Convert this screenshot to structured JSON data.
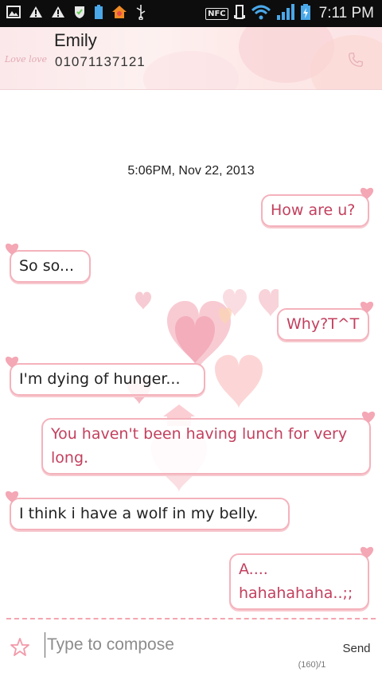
{
  "status_bar": {
    "time": "7:11 PM",
    "nfc_label": "NFC",
    "icons": [
      "image-icon",
      "warning-icon",
      "warning-icon",
      "shield-check-icon",
      "battery-saver-icon",
      "home-app-icon",
      "usb-icon",
      "nfc-icon",
      "vibrate-icon",
      "wifi-icon",
      "signal-icon",
      "battery-charging-icon"
    ]
  },
  "contact": {
    "name": "Emily",
    "number": "01071137121",
    "logo_text": "Love love"
  },
  "conversation": {
    "timestamp": "5:06PM, Nov 22, 2013",
    "messages": [
      {
        "direction": "outgoing",
        "text": "How are u?"
      },
      {
        "direction": "incoming",
        "text": "So so..."
      },
      {
        "direction": "outgoing",
        "text": "Why?T^T"
      },
      {
        "direction": "incoming",
        "text": "I'm dying of hunger..."
      },
      {
        "direction": "outgoing",
        "text": "You haven't been having lunch for very long."
      },
      {
        "direction": "incoming",
        "text": "I think i have a wolf in my belly."
      },
      {
        "direction": "outgoing",
        "text": "A.... hahahahaha..;;"
      }
    ]
  },
  "composer": {
    "placeholder": "Type to compose",
    "value": "",
    "send_label": "Send",
    "counter": "(160)/1"
  },
  "colors": {
    "accent_pink": "#f4b2bc",
    "outgoing_text": "#c3405e",
    "incoming_text": "#222222",
    "status_bar_bg": "#0d0d0d"
  }
}
